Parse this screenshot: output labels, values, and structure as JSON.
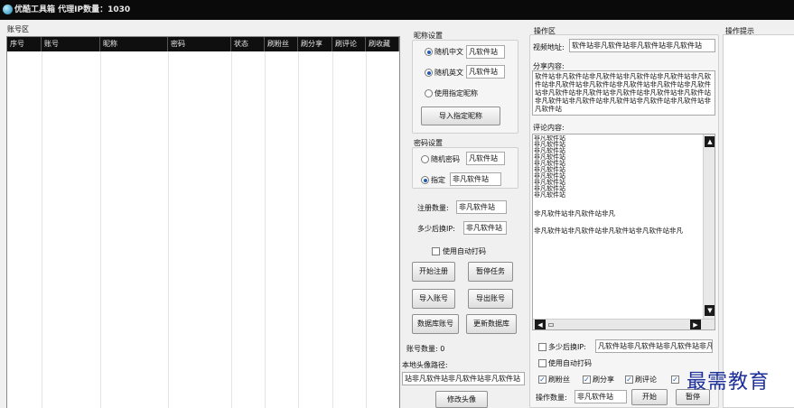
{
  "app": {
    "title": "优酷工具箱  代理IP数量：1030",
    "watermark": "最需教育"
  },
  "account_area": {
    "group_label": "账号区",
    "columns": [
      "序号",
      "账号",
      "昵称",
      "密码",
      "状态",
      "刷粉丝",
      "刷分享",
      "刷评论",
      "刷收藏"
    ]
  },
  "nickname_settings": {
    "group_label": "昵称设置",
    "random_cn_label": "随机中文",
    "random_cn_value": "凡软件站",
    "random_en_label": "随机英文",
    "random_en_value": "凡软件站",
    "use_specified_label": "使用指定昵称",
    "import_button": "导入指定昵称"
  },
  "password_settings": {
    "group_label": "密码设置",
    "random_label": "随机密码",
    "random_value": "凡软件站",
    "specified_label": "指定",
    "specified_value": "非凡软件站"
  },
  "register": {
    "count_label": "注册数量:",
    "count_value": "非凡软件站",
    "switch_ip_label": "多少后换IP:",
    "switch_ip_value": "非凡软件站",
    "auto_captcha_label": "使用自动打码",
    "start_register": "开始注册",
    "pause_task": "暂停任务",
    "import_accounts": "导入账号",
    "export_accounts": "导出账号",
    "db_accounts": "数据库账号",
    "update_db": "更新数据库",
    "account_count_label": "账号数量: 0",
    "avatar_path_label": "本地头像路径:",
    "avatar_path_value": "站非凡软件站非凡软件站非凡软件站",
    "change_avatar": "修改头像"
  },
  "operation_area": {
    "group_label": "操作区",
    "video_url_label": "视频地址:",
    "video_url_value": "软件站非凡软件站非凡软件站非凡软件站",
    "share_label": "分享内容:",
    "share_text": "软件站非凡软件站非凡软件站非凡软件站非凡软件站非凡软件站非凡软件站非凡软件站非凡软件站非凡软件站非凡软件站非凡软件站非凡软件站非凡软件站非凡软件站非凡软件站非凡软件站非凡软件站非凡软件站非凡软件站非凡软件站非凡软件站",
    "comment_label": "评论内容:",
    "comment_lines": [
      "非凡软件站",
      "非凡软件站",
      "非凡软件站",
      "非凡软件站",
      "非凡软件站",
      "非凡软件站",
      "非凡软件站",
      "非凡软件站",
      "非凡软件站",
      "非凡软件站"
    ],
    "comment_line_a": "非凡软件站非凡软件站非凡",
    "comment_line_b": "非凡软件站非凡软件站非凡软件站非凡软件站非凡",
    "switch_ip_label": "多少后换IP:",
    "switch_ip_value": "凡软件站非凡软件站非凡软件站非凡软件站",
    "auto_captcha_label": "使用自动打码",
    "opt_fans": "刷粉丝",
    "opt_share": "刷分享",
    "opt_comment": "刷评论",
    "op_count_label": "操作数量:",
    "op_count_value": "非凡软件站",
    "start": "开始",
    "pause": "暂停"
  },
  "tips_area": {
    "group_label": "操作提示"
  },
  "colors": {
    "titlebar": "#0a0a0a",
    "radio_dot": "#1e5bb8",
    "watermark": "#1c2f9a"
  }
}
